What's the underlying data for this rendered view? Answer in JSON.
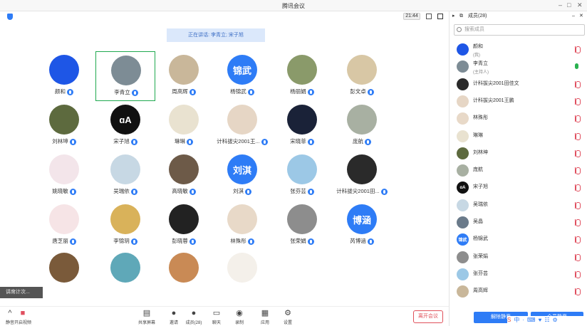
{
  "window": {
    "title": "腾讯会议",
    "timer": "21:44"
  },
  "colors": {
    "accent": "#2e7cf6",
    "active_border": "#1fa94f",
    "leave": "#e0505a"
  },
  "speaking": {
    "text": "正在讲话: 李青立; 宋子旭"
  },
  "tiles": [
    {
      "name": "颜和",
      "avatar_text": "",
      "bg": "#1e56e6"
    },
    {
      "name": "李青立",
      "avatar_text": "",
      "bg": "#7d8c95"
    },
    {
      "name": "周高辉",
      "avatar_text": "",
      "bg": "#c9b79a"
    },
    {
      "name": "杨锦武",
      "avatar_text": "锦武",
      "bg": "#2e7cf6"
    },
    {
      "name": "杨丽娟",
      "avatar_text": "",
      "bg": "#8a9a6a"
    },
    {
      "name": "彭文卓",
      "avatar_text": "",
      "bg": "#d8c7a5"
    },
    {
      "name": "刘林坤",
      "avatar_text": "",
      "bg": "#5d6a3e"
    },
    {
      "name": "宋子旭",
      "avatar_text": "ɑA",
      "bg": "#111111"
    },
    {
      "name": "琳琳",
      "avatar_text": "",
      "bg": "#e9e2d0"
    },
    {
      "name": "计科拔尖2001王...",
      "avatar_text": "",
      "bg": "#e6d6c5"
    },
    {
      "name": "宋晓菲",
      "avatar_text": "",
      "bg": "#1a2238"
    },
    {
      "name": "庞航",
      "avatar_text": "",
      "bg": "#a8b0a2"
    },
    {
      "name": "姚晓敏",
      "avatar_text": "",
      "bg": "#f3e5ea"
    },
    {
      "name": "吴瑞依",
      "avatar_text": "",
      "bg": "#c7d8e4"
    },
    {
      "name": "高晓敏",
      "avatar_text": "",
      "bg": "#6d5a48"
    },
    {
      "name": "刘淇",
      "avatar_text": "刘淇",
      "bg": "#2e7cf6"
    },
    {
      "name": "张芬芸",
      "avatar_text": "",
      "bg": "#9cc8e6"
    },
    {
      "name": "计科拔尖2001田...",
      "avatar_text": "",
      "bg": "#2a2a2a"
    },
    {
      "name": "唐芝丽",
      "avatar_text": "",
      "bg": "#f6e4e6"
    },
    {
      "name": "李锦玥",
      "avatar_text": "",
      "bg": "#d9b25a"
    },
    {
      "name": "彭晓蓉",
      "avatar_text": "",
      "bg": "#222222"
    },
    {
      "name": "林殊彤",
      "avatar_text": "",
      "bg": "#e8d9c8"
    },
    {
      "name": "张荣娟",
      "avatar_text": "",
      "bg": "#8d8d8d"
    },
    {
      "name": "芮博涵",
      "avatar_text": "博涵",
      "bg": "#2e7cf6"
    },
    {
      "name": "",
      "avatar_text": "",
      "bg": "#7a5a3a"
    },
    {
      "name": "",
      "avatar_text": "",
      "bg": "#5fa8b8"
    },
    {
      "name": "",
      "avatar_text": "",
      "bg": "#c98a55"
    },
    {
      "name": "",
      "avatar_text": "",
      "bg": "#f4f0ea"
    }
  ],
  "minibar": {
    "label": "讲席计次..."
  },
  "bottombar": {
    "mute_label": "静音",
    "video_label": "开启视频",
    "buttons": [
      {
        "label": "共享屏幕",
        "icon": "share-screen-icon",
        "glyph": "▤"
      },
      {
        "label": "邀请",
        "icon": "invite-icon",
        "glyph": "●"
      },
      {
        "label": "成员(28)",
        "icon": "members-icon",
        "glyph": "●"
      },
      {
        "label": "聊天",
        "icon": "chat-icon",
        "glyph": "▭"
      },
      {
        "label": "录制",
        "icon": "record-icon",
        "glyph": "◉"
      },
      {
        "label": "应用",
        "icon": "apps-icon",
        "glyph": "▦"
      },
      {
        "label": "设置",
        "icon": "settings-icon",
        "glyph": "⚙"
      }
    ],
    "leave_label": "离开会议"
  },
  "panel": {
    "title": "成员(28)",
    "search_placeholder": "搜索成员",
    "members": [
      {
        "name": "颜和",
        "role": "(我)",
        "bg": "#1e56e6",
        "text": "",
        "mic": "muted"
      },
      {
        "name": "李青立",
        "role": "(主持人)",
        "bg": "#7d8c95",
        "text": "",
        "mic": "on"
      },
      {
        "name": "计科拔尖2001田佳文",
        "role": "",
        "bg": "#2a2a2a",
        "text": "",
        "mic": "muted"
      },
      {
        "name": "计科拔尖2001王鹏",
        "role": "",
        "bg": "#e6d6c5",
        "text": "",
        "mic": "muted"
      },
      {
        "name": "林殊彤",
        "role": "",
        "bg": "#e8d9c8",
        "text": "",
        "mic": "muted"
      },
      {
        "name": "琳琳",
        "role": "",
        "bg": "#e9e2d0",
        "text": "",
        "mic": "muted"
      },
      {
        "name": "刘林坤",
        "role": "",
        "bg": "#5d6a3e",
        "text": "",
        "mic": "muted"
      },
      {
        "name": "庞航",
        "role": "",
        "bg": "#a8b0a2",
        "text": "",
        "mic": "muted"
      },
      {
        "name": "宋子旭",
        "role": "",
        "bg": "#111111",
        "text": "ɑA",
        "mic": "muted"
      },
      {
        "name": "吴瑞依",
        "role": "",
        "bg": "#c7d8e4",
        "text": "",
        "mic": "muted"
      },
      {
        "name": "吴晶",
        "role": "",
        "bg": "#6a7a8a",
        "text": "",
        "mic": "muted"
      },
      {
        "name": "杨锦武",
        "role": "",
        "bg": "#2e7cf6",
        "text": "锦武",
        "mic": "muted"
      },
      {
        "name": "张荣娟",
        "role": "",
        "bg": "#8d8d8d",
        "text": "",
        "mic": "muted"
      },
      {
        "name": "张芬芸",
        "role": "",
        "bg": "#9cc8e6",
        "text": "",
        "mic": "muted"
      },
      {
        "name": "周高辉",
        "role": "",
        "bg": "#c9b79a",
        "text": "",
        "mic": "muted"
      }
    ],
    "mute_all_label": "解除静音",
    "mute_all2_label": "全员静音"
  },
  "tray": {
    "items": [
      "S",
      "中",
      "·",
      "⌨",
      "♥",
      "☷",
      "⚙"
    ]
  }
}
